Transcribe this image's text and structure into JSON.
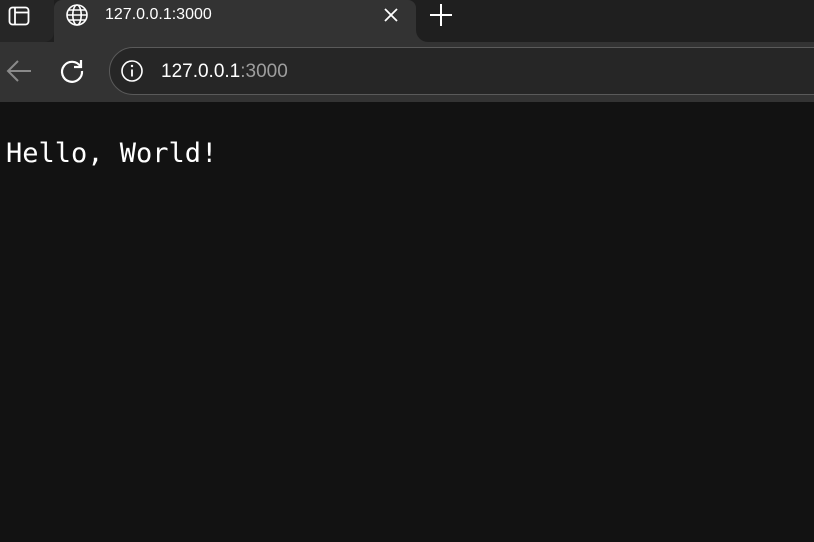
{
  "tabstrip": {
    "tab_actions_icon": "tab-actions-icon",
    "tab": {
      "title": "127.0.0.1:3000",
      "favicon": "globe-icon",
      "close_icon": "close-icon"
    },
    "new_tab_icon": "plus-icon"
  },
  "toolbar": {
    "back_icon": "arrow-left-icon",
    "reload_icon": "reload-icon",
    "address": {
      "info_icon": "info-icon",
      "host": "127.0.0.1",
      "port": ":3000"
    }
  },
  "page": {
    "text": "Hello, World!"
  },
  "colors": {
    "page_background": "#121212",
    "toolbar": "#333333",
    "tabstrip": "#1f1f1f",
    "text": "#ffffff",
    "url_muted": "#9e9e9e"
  }
}
